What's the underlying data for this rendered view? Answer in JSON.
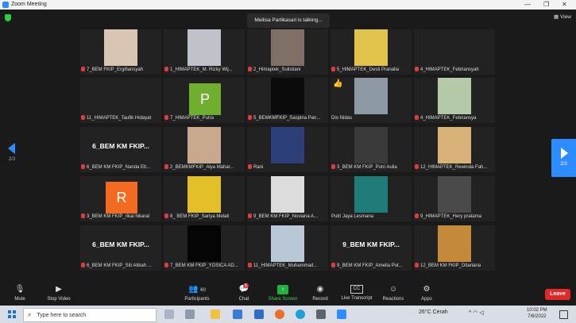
{
  "window": {
    "title": "Zoom Meeting",
    "minimize": "—",
    "restore": "❐",
    "close": "✕"
  },
  "talking_indicator": "Meilisa Partikasari is talking...",
  "view_button": {
    "label": "View",
    "icon": "view-grid-icon"
  },
  "pagination": {
    "left": "2/3",
    "right": "2/3"
  },
  "colors": {
    "accent": "#2d8cff",
    "muted": "#e23b3b",
    "leave": "#e02828",
    "share": "#1fb141"
  },
  "participants": [
    {
      "name": "7_BEM FKIP_Ergifiansyah",
      "photo": "#d8c6b2",
      "muted": true
    },
    {
      "name": "1_HIMAPTEK_M. Rizky Wij...",
      "photo": "#bfc3c9",
      "muted": true
    },
    {
      "name": "2_Himaptek_Sulistiani",
      "photo": "#7f6f66",
      "muted": true
    },
    {
      "name": "5_HIMAPTEK_Desti Pranalia",
      "photo": "#e1c24a",
      "muted": true
    },
    {
      "name": "4_HIMAPTEK_Febriansyah",
      "muted": true
    },
    {
      "name": "11_HIMAPTEK_Taufik Hidayat",
      "muted": true
    },
    {
      "name": "7_HIMAPTEK_Putra",
      "letter": "P",
      "letter_bg": "#6fae2e",
      "muted": true
    },
    {
      "name": "5_BEMKMFKIP_Saspina Pan...",
      "photo": "#0b0b0b",
      "muted": true
    },
    {
      "name": "Dio Nidas",
      "photo": "#8d9aa6",
      "muted": false,
      "reaction": "👍"
    },
    {
      "name": "4_HIMAPTEK_Febriansya",
      "photo": "#b4c9a7",
      "muted": true
    },
    {
      "name": "6_BEM KM FKIP_Nanda Elt...",
      "label": "6_BEM KM FKIP...",
      "muted": true
    },
    {
      "name": "2_BEMKMFKIP_Alya Mahar...",
      "photo": "#c9a98e",
      "muted": true
    },
    {
      "name": "Rani",
      "photo": "#2c3f78",
      "muted": true
    },
    {
      "name": "3_BEM KM FKIP_Putri Aulia",
      "photo": "#3a3a3a",
      "muted": true
    },
    {
      "name": "12_HIMAPTEK_Rewinda Fah...",
      "photo": "#d9b27a",
      "muted": true
    },
    {
      "name": "3_BEM KM FKIP_rikal hikaral",
      "letter": "R",
      "letter_bg": "#f26b21",
      "muted": true
    },
    {
      "name": "8_ BEM FKIP_Sariya Melati",
      "photo": "#e3c02a",
      "muted": true
    },
    {
      "name": "9_BEM KM FKIP_Noviana A...",
      "photo": "#dcdcdc",
      "muted": true
    },
    {
      "name": "Putri Jaya Lesmana",
      "photo": "#1f7c78",
      "muted": false
    },
    {
      "name": "9_HIMAPTEK_Hery pratama",
      "photo": "#4a4a4a",
      "muted": true
    },
    {
      "name": "6_BEM KM FKIP_Siti Atikah ...",
      "label": "6_BEM KM FKIP...",
      "muted": true
    },
    {
      "name": "7_BEM KM FKIP_YOSICA AD...",
      "photo": "#050505",
      "muted": true
    },
    {
      "name": "11_HIMAPTEK_Muhammad...",
      "photo": "#b8c8d6",
      "muted": true
    },
    {
      "name": "9_BEM KM FKIP_Amelia Put...",
      "label": "9_BEM KM FKIP...",
      "muted": true
    },
    {
      "name": "12_BEM KM FKIP_Ditariana",
      "photo": "#c48a3a",
      "muted": true
    }
  ],
  "toolbar": {
    "mute": "Mute",
    "stop_video": "Stop Video",
    "participants": "Participants",
    "participants_count": "60",
    "chat": "Chat",
    "chat_badge": "6",
    "share_screen": "Share Screen",
    "record": "Record",
    "live_transcript": "Live Transcript",
    "live_transcript_icon_text": "CC",
    "reactions": "Reactions",
    "apps": "Apps",
    "leave": "Leave"
  },
  "taskbar": {
    "search_placeholder": "Type here to search",
    "weather": "26°C  Cerah",
    "time": "10:02 PM",
    "date": "7/6/2022"
  }
}
